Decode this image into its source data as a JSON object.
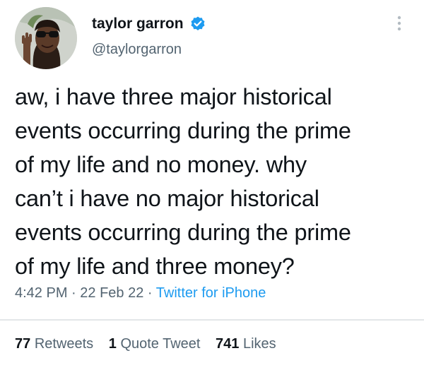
{
  "author": {
    "display_name": "taylor garron",
    "handle": "@taylorgarron",
    "verified": true,
    "verified_color": "#1d9bf0"
  },
  "tweet": {
    "text": "aw, i have three major historical\nevents occurring during the prime\nof my life and no money. why\ncan’t i have no major historical\nevents occurring during the prime\nof my life and three money?"
  },
  "meta": {
    "time": "4:42 PM",
    "separator": " · ",
    "date": "22 Feb 22",
    "source": "Twitter for iPhone"
  },
  "stats": {
    "retweets_count": "77",
    "retweets_label": "Retweets",
    "quotes_count": "1",
    "quotes_label": "Quote Tweet",
    "likes_count": "741",
    "likes_label": "Likes"
  },
  "icons": {
    "verified": "verified-badge-icon",
    "more": "more-options-icon"
  },
  "colors": {
    "text": "#0f1419",
    "secondary": "#536471",
    "link": "#1d9bf0"
  }
}
